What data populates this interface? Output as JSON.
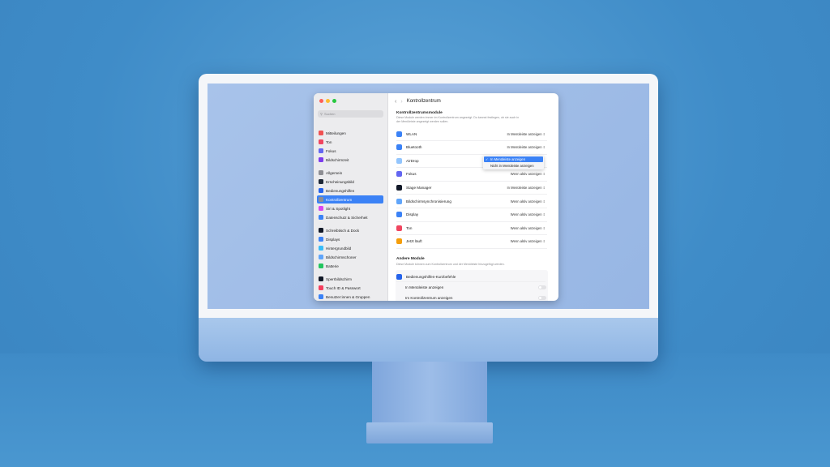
{
  "window": {
    "title": "Kontrollzentrum",
    "search_placeholder": "Suchen"
  },
  "sidebar": {
    "items": [
      {
        "label": "Mitteilungen",
        "icon": "bell-icon",
        "color": "#f05252"
      },
      {
        "label": "Ton",
        "icon": "speaker-icon",
        "color": "#f0455f"
      },
      {
        "label": "Fokus",
        "icon": "moon-icon",
        "color": "#6366f1"
      },
      {
        "label": "Bildschirmzeit",
        "icon": "hourglass-icon",
        "color": "#7c3aed"
      },
      {
        "label": "Allgemein",
        "icon": "gear-icon",
        "color": "#8e8e93"
      },
      {
        "label": "Erscheinungsbild",
        "icon": "appearance-icon",
        "color": "#1f2937"
      },
      {
        "label": "Bedienungshilfen",
        "icon": "accessibility-icon",
        "color": "#2563eb"
      },
      {
        "label": "Kontrollzentrum",
        "icon": "control-center-icon",
        "color": "#8e8e93",
        "active": true
      },
      {
        "label": "Siri & Spotlight",
        "icon": "siri-icon",
        "color": "#d946ef"
      },
      {
        "label": "Datenschutz & Sicherheit",
        "icon": "hand-icon",
        "color": "#3b82f6"
      },
      {
        "label": "Schreibtisch & Dock",
        "icon": "dock-icon",
        "color": "#111827"
      },
      {
        "label": "Displays",
        "icon": "display-icon",
        "color": "#3b82f6"
      },
      {
        "label": "Hintergrundbild",
        "icon": "wallpaper-icon",
        "color": "#38bdf8"
      },
      {
        "label": "Bildschirmschoner",
        "icon": "screensaver-icon",
        "color": "#60a5fa"
      },
      {
        "label": "Batterie",
        "icon": "battery-icon",
        "color": "#22c55e"
      },
      {
        "label": "Sperrbildschirm",
        "icon": "lock-icon",
        "color": "#111827"
      },
      {
        "label": "Touch ID & Passwort",
        "icon": "fingerprint-icon",
        "color": "#f43f5e"
      },
      {
        "label": "Benutzer:innen & Gruppen",
        "icon": "users-icon",
        "color": "#3b82f6"
      }
    ]
  },
  "main": {
    "section_title": "Kontrollzentrumsmodule",
    "section_desc_1": "Diese Module werden immer im Kontrollzentrum angezeigt. Du kannst festlegen, ob sie auch in",
    "section_desc_2": "der Menüleiste angezeigt werden sollen.",
    "modules": [
      {
        "label": "WLAN",
        "value": "In Menüleiste anzeigen",
        "icon": "wifi-icon",
        "color": "#3b82f6"
      },
      {
        "label": "Bluetooth",
        "value": "In Menüleiste anzeigen",
        "icon": "bluetooth-icon",
        "color": "#3b82f6"
      },
      {
        "label": "AirDrop",
        "value": "",
        "icon": "airdrop-icon",
        "color": "#93c5fd"
      },
      {
        "label": "Fokus",
        "value": "Wenn aktiv anzeigen",
        "icon": "moon-icon",
        "color": "#6366f1"
      },
      {
        "label": "Stage Manager",
        "value": "In Menüleiste anzeigen",
        "icon": "stage-manager-icon",
        "color": "#111827"
      },
      {
        "label": "Bildschirmsynchronisierung",
        "value": "Wenn aktiv anzeigen",
        "icon": "screen-mirroring-icon",
        "color": "#60a5fa"
      },
      {
        "label": "Display",
        "value": "Wenn aktiv anzeigen",
        "icon": "brightness-icon",
        "color": "#3b82f6"
      },
      {
        "label": "Ton",
        "value": "Wenn aktiv anzeigen",
        "icon": "speaker-icon",
        "color": "#f0455f"
      },
      {
        "label": "Jetzt läuft",
        "value": "Wenn aktiv anzeigen",
        "icon": "play-icon",
        "color": "#f59e0b"
      }
    ],
    "popup": {
      "options": [
        "In Menüleiste anzeigen",
        "Nicht in Menüleiste anzeigen"
      ]
    },
    "other_title": "Andere Module",
    "other_desc": "Diese Module können zum Kontrollzentrum und der Menüleiste hinzugefügt werden.",
    "other_item": "Bedienungshilfen-Kurzbefehle",
    "other_rows": [
      "In Menüleiste anzeigen",
      "Im Kontrollzentrum anzeigen"
    ]
  }
}
